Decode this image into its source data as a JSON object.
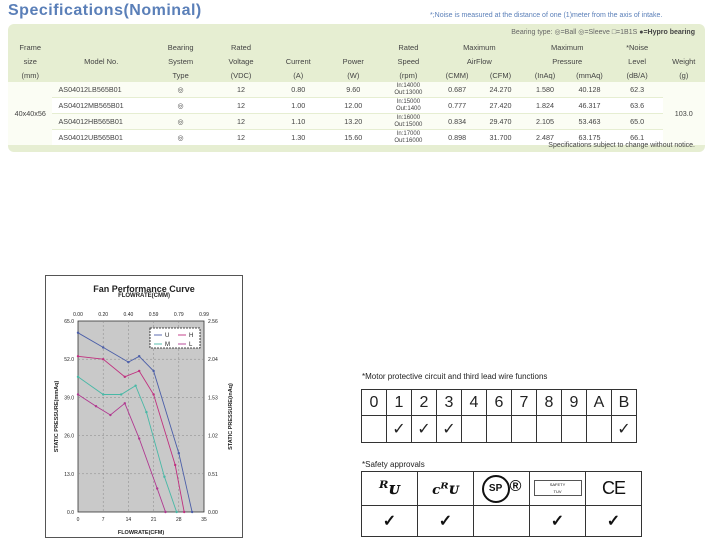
{
  "title": "Specifications(Nominal)",
  "noise_note": "*;Noise is measured at the distance of one (1)meter from the axis of intake.",
  "bearing_legend": {
    "label": "Bearing type:",
    "items": "◎=Ball ◎=Sleeve □=1B1S",
    "hypro": "●=Hypro bearing"
  },
  "table": {
    "headers_row1": [
      "Frame",
      "",
      "Bearing",
      "Rated",
      "",
      "",
      "Rated",
      "Maximum",
      "Maximum",
      "*Noise",
      ""
    ],
    "headers_row2": [
      "size",
      "Model No.",
      "System",
      "Voltage",
      "Current",
      "Power",
      "Speed",
      "AirFlow",
      "Pressure",
      "Level",
      "Weight"
    ],
    "headers_row3": [
      "(mm)",
      "",
      "Type",
      "(VDC)",
      "(A)",
      "(W)",
      "(rpm)",
      "(CMM)",
      "(CFM)",
      "(InAq)",
      "(mmAq)",
      "(dB/A)",
      "(g)"
    ],
    "frame_size": "40x40x56",
    "weight": "103.0",
    "rows": [
      {
        "model": "AS04012LB565B01",
        "bearing": "◎",
        "voltage": "12",
        "current": "0.80",
        "power": "9.60",
        "speed_in": "In:14000",
        "speed_out": "Out:13000",
        "cmm": "0.687",
        "cfm": "24.270",
        "inaq": "1.580",
        "mmaq": "40.128",
        "noise": "62.3"
      },
      {
        "model": "AS04012MB565B01",
        "bearing": "◎",
        "voltage": "12",
        "current": "1.00",
        "power": "12.00",
        "speed_in": "In:15000",
        "speed_out": "Out:1400",
        "cmm": "0.777",
        "cfm": "27.420",
        "inaq": "1.824",
        "mmaq": "46.317",
        "noise": "63.6"
      },
      {
        "model": "AS04012HB565B01",
        "bearing": "◎",
        "voltage": "12",
        "current": "1.10",
        "power": "13.20",
        "speed_in": "In:16000",
        "speed_out": "Out:15000",
        "cmm": "0.834",
        "cfm": "29.470",
        "inaq": "2.105",
        "mmaq": "53.463",
        "noise": "65.0"
      },
      {
        "model": "AS04012UB565B01",
        "bearing": "◎",
        "voltage": "12",
        "current": "1.30",
        "power": "15.60",
        "speed_in": "In:17000",
        "speed_out": "Out:16000",
        "cmm": "0.898",
        "cfm": "31.700",
        "inaq": "2.487",
        "mmaq": "63.175",
        "noise": "66.1"
      }
    ]
  },
  "change_note": "Specifications subject to change without notice.",
  "chart_data": {
    "type": "line",
    "title": "Fan Performance Curve",
    "x_top_label": "FLOWRATE(CMM)",
    "xlabel": "FLOWRATE(CFM)",
    "ylabel_left": "STATIC PRESSURE(mmAq)",
    "ylabel_right": "STATIC PRESSURE(inAq)",
    "x_bottom_ticks": [
      "0",
      "7",
      "14",
      "21",
      "28",
      "35"
    ],
    "x_top_ticks": [
      "0.00",
      "0.20",
      "0.40",
      "0.59",
      "0.79",
      "0.99"
    ],
    "y_left_ticks": [
      "0.0",
      "13.0",
      "26.0",
      "39.0",
      "52.0",
      "65.0"
    ],
    "y_right_ticks": [
      "0.00",
      "0.51",
      "1.02",
      "1.53",
      "2.04",
      "2.56"
    ],
    "xlim": [
      0,
      35
    ],
    "ylim": [
      0,
      65
    ],
    "series": [
      {
        "name": "U",
        "color": "#4b5ea8",
        "marker": "+",
        "x": [
          0,
          7,
          14,
          17,
          21,
          28,
          31.7
        ],
        "y": [
          61,
          56,
          51,
          53,
          48,
          20,
          0
        ]
      },
      {
        "name": "H",
        "color": "#c0307f",
        "marker": "*",
        "x": [
          0,
          7,
          13,
          17,
          21,
          27,
          29.5
        ],
        "y": [
          53,
          52,
          46,
          48,
          40,
          16,
          0
        ]
      },
      {
        "name": "M",
        "color": "#48b8a6",
        "marker": "*",
        "x": [
          0,
          7,
          12,
          16,
          19,
          24,
          27.4
        ],
        "y": [
          46,
          40,
          40,
          43,
          34,
          12,
          0
        ]
      },
      {
        "name": "L",
        "color": "#b03890",
        "marker": "+",
        "x": [
          0,
          5,
          9,
          13,
          17,
          22,
          24.3
        ],
        "y": [
          40,
          36,
          33,
          37,
          25,
          8,
          0
        ]
      }
    ]
  },
  "motor": {
    "note": "*Motor protective circuit and third lead wire functions",
    "codes": [
      "0",
      "1",
      "2",
      "3",
      "4",
      "6",
      "7",
      "8",
      "9",
      "A",
      "B"
    ],
    "checks": [
      "",
      "✓",
      "✓",
      "✓",
      "",
      "",
      "",
      "",
      "",
      "",
      "✓"
    ]
  },
  "safety": {
    "note": "*Safety approvals",
    "logos": [
      "UL",
      "cUL",
      "SP",
      "TUV",
      "CE"
    ],
    "logo_text": {
      "ul": "ᴿᴜ",
      "c": "c",
      "ul2": "ᴿᴜ",
      "csa": "SP",
      "reg": "®",
      "tuv_line1": "SAFETY",
      "tuv_line2": "TUV",
      "ce": "CE"
    },
    "checks": [
      "✓",
      "✓",
      "",
      "✓",
      "✓"
    ]
  }
}
